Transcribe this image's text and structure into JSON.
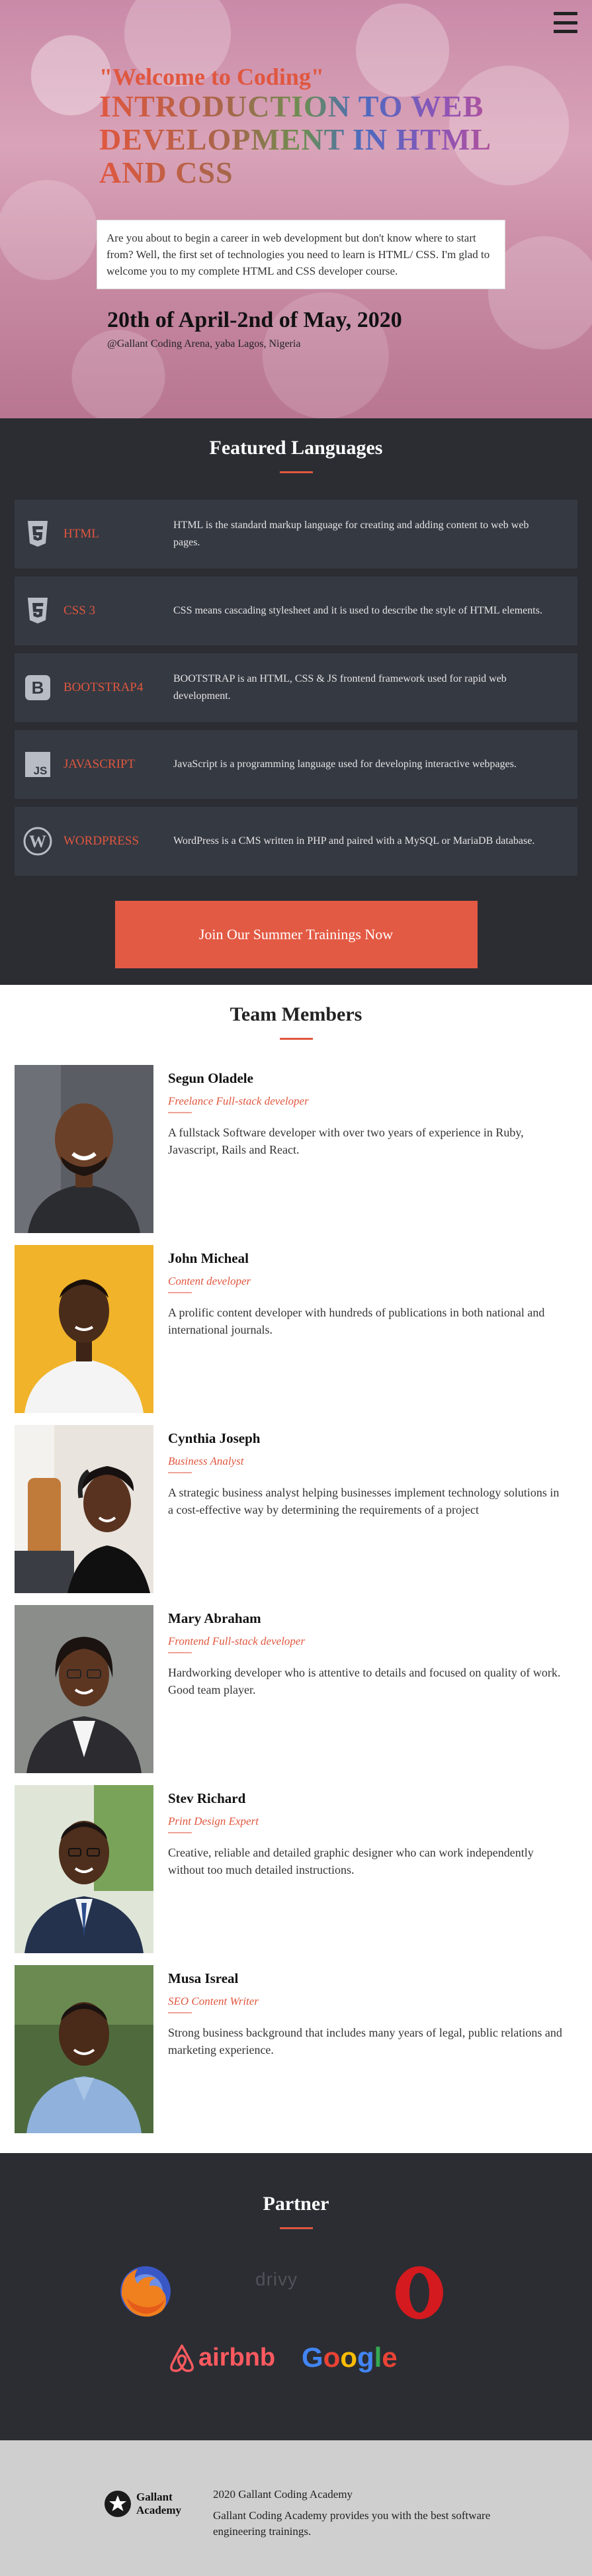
{
  "hero": {
    "welcome": "\"Welcome to Coding\"",
    "title": "INTRODUCTION TO WEB DEVELOPMENT IN HTML AND CSS",
    "intro": "Are you about to begin a career in web development but don't know where to start from? Well, the first set of technologies you need to learn is HTML/ CSS. I'm glad to welcome you to my complete HTML and CSS developer course.",
    "date": "20th of April-2nd of May, 2020",
    "venue": "@Gallant Coding Arena, yaba Lagos, Nigeria"
  },
  "languages": {
    "title": "Featured Languages",
    "items": [
      {
        "name": "HTML",
        "icon": "html5-icon",
        "desc": "HTML is the standard markup language for creating and adding content to web web pages."
      },
      {
        "name": "CSS 3",
        "icon": "css3-icon",
        "desc": "CSS means cascading stylesheet and it is used to describe the style of HTML elements."
      },
      {
        "name": "BOOTSTRAP4",
        "icon": "bootstrap-icon",
        "desc": "BOOTSTRAP is an HTML, CSS & JS frontend framework used for rapid web development."
      },
      {
        "name": "JAVASCRIPT",
        "icon": "javascript-icon",
        "desc": "JavaScript is a programming language used for developing interactive webpages."
      },
      {
        "name": "WORDPRESS",
        "icon": "wordpress-icon",
        "desc": "WordPress is a CMS written in PHP and paired with a MySQL or MariaDB database."
      }
    ],
    "cta": "Join Our Summer Trainings Now"
  },
  "team": {
    "title": "Team Members",
    "members": [
      {
        "name": "Segun Oladele",
        "role": "Freelance Full-stack developer",
        "bio": "A fullstack Software developer with over two years of experience in Ruby, Javascript, Rails and React."
      },
      {
        "name": "John Micheal",
        "role": "Content developer",
        "bio": "A prolific content developer with hundreds of publications in both national and international journals."
      },
      {
        "name": "Cynthia Joseph",
        "role": "Business Analyst",
        "bio": "A strategic business analyst helping businesses implement technology solutions in a cost-effective way by determining the requirements of a project"
      },
      {
        "name": "Mary Abraham",
        "role": "Frontend Full-stack developer",
        "bio": "Hardworking developer who is attentive to details and focused on quality of work. Good team player."
      },
      {
        "name": "Stev Richard",
        "role": "Print Design Expert",
        "bio": "Creative, reliable and detailed graphic designer who can work independently without too much detailed instructions."
      },
      {
        "name": "Musa Isreal",
        "role": "SEO Content Writer",
        "bio": "Strong business background that includes many years of legal, public relations and marketing experience."
      }
    ]
  },
  "partners": {
    "title": "Partner",
    "logos": {
      "drivy": "drivy",
      "airbnb": "airbnb"
    }
  },
  "footer": {
    "brand_line1": "Gallant",
    "brand_line2": "Academy",
    "copyright": "2020 Gallant Coding Academy",
    "tagline": "Gallant Coding Academy provides you with the best software engineering trainings."
  },
  "colors": {
    "accent": "#e0573f",
    "dark": "#2b2d33",
    "card": "#353942"
  }
}
